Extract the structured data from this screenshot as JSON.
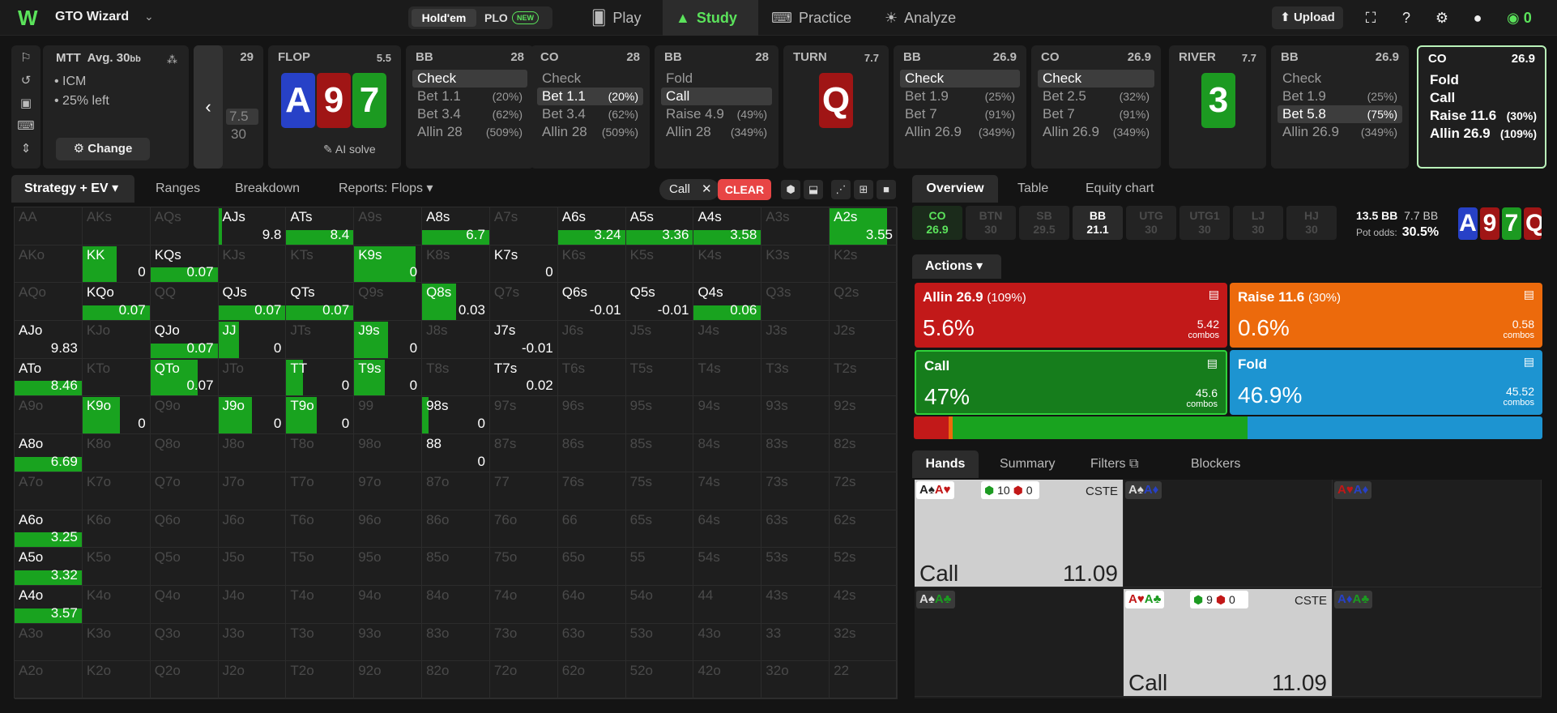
{
  "header": {
    "brand": "GTO Wizard",
    "game_a": "Hold'em",
    "game_b": "PLO",
    "game_new": "NEW",
    "nav": [
      "Play",
      "Study",
      "Practice",
      "Analyze"
    ],
    "upload": "Upload",
    "credits": "0"
  },
  "info": {
    "title": "MTT",
    "avg": "Avg. 30",
    "avg_unit": "bb",
    "line1": "ICM",
    "line2": "25% left",
    "change": "Change"
  },
  "preflop_stub": {
    "stack": "29",
    "a": "7.5",
    "b": "30"
  },
  "flop": {
    "label": "FLOP",
    "pot": "5.5",
    "cards": [
      "A",
      "9",
      "7"
    ],
    "ai": "AI solve"
  },
  "turn": {
    "label": "TURN",
    "pot": "7.7",
    "card": "Q"
  },
  "river": {
    "label": "RIVER",
    "pot": "7.7",
    "card": "3"
  },
  "columns": [
    {
      "pos": "BB",
      "stack": "28",
      "actions": [
        [
          "Check",
          ""
        ],
        [
          "Bet 1.1",
          "(20%)"
        ],
        [
          "Bet 3.4",
          "(62%)"
        ],
        [
          "Allin 28",
          "(509%)"
        ]
      ],
      "sel": 0
    },
    {
      "pos": "CO",
      "stack": "28",
      "actions": [
        [
          "Check",
          ""
        ],
        [
          "Bet 1.1",
          "(20%)"
        ],
        [
          "Bet 3.4",
          "(62%)"
        ],
        [
          "Allin 28",
          "(509%)"
        ]
      ],
      "sel": 1
    },
    {
      "pos": "BB",
      "stack": "28",
      "actions": [
        [
          "Fold",
          ""
        ],
        [
          "Call",
          ""
        ],
        [
          "Raise 4.9",
          "(49%)"
        ],
        [
          "Allin 28",
          "(349%)"
        ]
      ],
      "sel": 1
    },
    {
      "pos": "BB",
      "stack": "26.9",
      "actions": [
        [
          "Check",
          ""
        ],
        [
          "Bet 1.9",
          "(25%)"
        ],
        [
          "Bet 7",
          "(91%)"
        ],
        [
          "Allin 26.9",
          "(349%)"
        ]
      ],
      "sel": 0
    },
    {
      "pos": "CO",
      "stack": "26.9",
      "actions": [
        [
          "Check",
          ""
        ],
        [
          "Bet 2.5",
          "(32%)"
        ],
        [
          "Bet 7",
          "(91%)"
        ],
        [
          "Allin 26.9",
          "(349%)"
        ]
      ],
      "sel": 0
    },
    {
      "pos": "BB",
      "stack": "26.9",
      "actions": [
        [
          "Check",
          ""
        ],
        [
          "Bet 1.9",
          "(25%)"
        ],
        [
          "Bet 5.8",
          "(75%)"
        ],
        [
          "Allin 26.9",
          "(349%)"
        ]
      ],
      "sel": 2
    },
    {
      "pos": "CO",
      "stack": "26.9",
      "actions": [
        [
          "Fold",
          ""
        ],
        [
          "Call",
          ""
        ],
        [
          "Raise 11.6",
          "(30%)"
        ],
        [
          "Allin 26.9",
          "(109%)"
        ]
      ],
      "sel": -1
    }
  ],
  "ltabs": {
    "strategy": "Strategy + EV",
    "ranges": "Ranges",
    "breakdown": "Breakdown",
    "reports": "Reports: Flops",
    "chip": "Call",
    "clear": "CLEAR"
  },
  "matrix": {
    "cells": [
      [
        "AA",
        "",
        0
      ],
      [
        "AKs",
        "",
        0
      ],
      [
        "AQs",
        "",
        0
      ],
      [
        "AJs",
        "9.8",
        0.05
      ],
      [
        "ATs",
        "8.4",
        1
      ],
      [
        "A9s",
        "",
        0
      ],
      [
        "A8s",
        "6.7",
        1
      ],
      [
        "A7s",
        "",
        0
      ],
      [
        "A6s",
        "3.24",
        1
      ],
      [
        "A5s",
        "3.36",
        1
      ],
      [
        "A4s",
        "3.58",
        1
      ],
      [
        "A3s",
        "",
        0
      ],
      [
        "A2s",
        "3.55",
        0.85
      ],
      [
        "AKo",
        "",
        0
      ],
      [
        "KK",
        "0",
        0.5
      ],
      [
        "KQs",
        "0.07",
        1
      ],
      [
        "KJs",
        "",
        0
      ],
      [
        "KTs",
        "",
        0
      ],
      [
        "K9s",
        "0",
        0.9
      ],
      [
        "K8s",
        "",
        0
      ],
      [
        "K7s",
        "0",
        0
      ],
      [
        "K6s",
        "",
        0
      ],
      [
        "K5s",
        "",
        0
      ],
      [
        "K4s",
        "",
        0
      ],
      [
        "K3s",
        "",
        0
      ],
      [
        "K2s",
        "",
        0
      ],
      [
        "AQo",
        "",
        0
      ],
      [
        "KQo",
        "0.07",
        1
      ],
      [
        "QQ",
        "",
        0
      ],
      [
        "QJs",
        "0.07",
        1
      ],
      [
        "QTs",
        "0.07",
        1
      ],
      [
        "Q9s",
        "",
        0
      ],
      [
        "Q8s",
        "0.03",
        0.5
      ],
      [
        "Q7s",
        "",
        0
      ],
      [
        "Q6s",
        "-0.01",
        0
      ],
      [
        "Q5s",
        "-0.01",
        0
      ],
      [
        "Q4s",
        "0.06",
        1
      ],
      [
        "Q3s",
        "",
        0
      ],
      [
        "Q2s",
        "",
        0
      ],
      [
        "AJo",
        "9.83",
        0
      ],
      [
        "KJo",
        "",
        0
      ],
      [
        "QJo",
        "0.07",
        1
      ],
      [
        "JJ",
        "0",
        0.3
      ],
      [
        "JTs",
        "",
        0
      ],
      [
        "J9s",
        "0",
        0.5
      ],
      [
        "J8s",
        "",
        0
      ],
      [
        "J7s",
        "-0.01",
        0
      ],
      [
        "J6s",
        "",
        0
      ],
      [
        "J5s",
        "",
        0
      ],
      [
        "J4s",
        "",
        0
      ],
      [
        "J3s",
        "",
        0
      ],
      [
        "J2s",
        "",
        0
      ],
      [
        "ATo",
        "8.46",
        1
      ],
      [
        "KTo",
        "",
        0
      ],
      [
        "QTo",
        "0.07",
        0.7
      ],
      [
        "JTo",
        "",
        0
      ],
      [
        "TT",
        "0",
        0.25
      ],
      [
        "T9s",
        "0",
        0.45
      ],
      [
        "T8s",
        "",
        0
      ],
      [
        "T7s",
        "0.02",
        0
      ],
      [
        "T6s",
        "",
        0
      ],
      [
        "T5s",
        "",
        0
      ],
      [
        "T4s",
        "",
        0
      ],
      [
        "T3s",
        "",
        0
      ],
      [
        "T2s",
        "",
        0
      ],
      [
        "A9o",
        "",
        0
      ],
      [
        "K9o",
        "0",
        0.55
      ],
      [
        "Q9o",
        "",
        0
      ],
      [
        "J9o",
        "0",
        0.5
      ],
      [
        "T9o",
        "0",
        0.45
      ],
      [
        "99",
        "",
        0
      ],
      [
        "98s",
        "0",
        0.1
      ],
      [
        "97s",
        "",
        0
      ],
      [
        "96s",
        "",
        0
      ],
      [
        "95s",
        "",
        0
      ],
      [
        "94s",
        "",
        0
      ],
      [
        "93s",
        "",
        0
      ],
      [
        "92s",
        "",
        0
      ],
      [
        "A8o",
        "6.69",
        1
      ],
      [
        "K8o",
        "",
        0
      ],
      [
        "Q8o",
        "",
        0
      ],
      [
        "J8o",
        "",
        0
      ],
      [
        "T8o",
        "",
        0
      ],
      [
        "98o",
        "",
        0
      ],
      [
        "88",
        "0",
        0
      ],
      [
        "87s",
        "",
        0
      ],
      [
        "86s",
        "",
        0
      ],
      [
        "85s",
        "",
        0
      ],
      [
        "84s",
        "",
        0
      ],
      [
        "83s",
        "",
        0
      ],
      [
        "82s",
        "",
        0
      ],
      [
        "A7o",
        "",
        0
      ],
      [
        "K7o",
        "",
        0
      ],
      [
        "Q7o",
        "",
        0
      ],
      [
        "J7o",
        "",
        0
      ],
      [
        "T7o",
        "",
        0
      ],
      [
        "97o",
        "",
        0
      ],
      [
        "87o",
        "",
        0
      ],
      [
        "77",
        "",
        0
      ],
      [
        "76s",
        "",
        0
      ],
      [
        "75s",
        "",
        0
      ],
      [
        "74s",
        "",
        0
      ],
      [
        "73s",
        "",
        0
      ],
      [
        "72s",
        "",
        0
      ],
      [
        "A6o",
        "3.25",
        1
      ],
      [
        "K6o",
        "",
        0
      ],
      [
        "Q6o",
        "",
        0
      ],
      [
        "J6o",
        "",
        0
      ],
      [
        "T6o",
        "",
        0
      ],
      [
        "96o",
        "",
        0
      ],
      [
        "86o",
        "",
        0
      ],
      [
        "76o",
        "",
        0
      ],
      [
        "66",
        "",
        0
      ],
      [
        "65s",
        "",
        0
      ],
      [
        "64s",
        "",
        0
      ],
      [
        "63s",
        "",
        0
      ],
      [
        "62s",
        "",
        0
      ],
      [
        "A5o",
        "3.32",
        1
      ],
      [
        "K5o",
        "",
        0
      ],
      [
        "Q5o",
        "",
        0
      ],
      [
        "J5o",
        "",
        0
      ],
      [
        "T5o",
        "",
        0
      ],
      [
        "95o",
        "",
        0
      ],
      [
        "85o",
        "",
        0
      ],
      [
        "75o",
        "",
        0
      ],
      [
        "65o",
        "",
        0
      ],
      [
        "55",
        "",
        0
      ],
      [
        "54s",
        "",
        0
      ],
      [
        "53s",
        "",
        0
      ],
      [
        "52s",
        "",
        0
      ],
      [
        "A4o",
        "3.57",
        1
      ],
      [
        "K4o",
        "",
        0
      ],
      [
        "Q4o",
        "",
        0
      ],
      [
        "J4o",
        "",
        0
      ],
      [
        "T4o",
        "",
        0
      ],
      [
        "94o",
        "",
        0
      ],
      [
        "84o",
        "",
        0
      ],
      [
        "74o",
        "",
        0
      ],
      [
        "64o",
        "",
        0
      ],
      [
        "54o",
        "",
        0
      ],
      [
        "44",
        "",
        0
      ],
      [
        "43s",
        "",
        0
      ],
      [
        "42s",
        "",
        0
      ],
      [
        "A3o",
        "",
        0
      ],
      [
        "K3o",
        "",
        0
      ],
      [
        "Q3o",
        "",
        0
      ],
      [
        "J3o",
        "",
        0
      ],
      [
        "T3o",
        "",
        0
      ],
      [
        "93o",
        "",
        0
      ],
      [
        "83o",
        "",
        0
      ],
      [
        "73o",
        "",
        0
      ],
      [
        "63o",
        "",
        0
      ],
      [
        "53o",
        "",
        0
      ],
      [
        "43o",
        "",
        0
      ],
      [
        "33",
        "",
        0
      ],
      [
        "32s",
        "",
        0
      ],
      [
        "A2o",
        "",
        0
      ],
      [
        "K2o",
        "",
        0
      ],
      [
        "Q2o",
        "",
        0
      ],
      [
        "J2o",
        "",
        0
      ],
      [
        "T2o",
        "",
        0
      ],
      [
        "92o",
        "",
        0
      ],
      [
        "82o",
        "",
        0
      ],
      [
        "72o",
        "",
        0
      ],
      [
        "62o",
        "",
        0
      ],
      [
        "52o",
        "",
        0
      ],
      [
        "42o",
        "",
        0
      ],
      [
        "32o",
        "",
        0
      ],
      [
        "22",
        "",
        0
      ]
    ]
  },
  "rtabs": {
    "overview": "Overview",
    "table": "Table",
    "equity": "Equity chart"
  },
  "positions": [
    [
      "CO",
      "26.9"
    ],
    [
      "BTN",
      "30"
    ],
    [
      "SB",
      "29.5"
    ],
    [
      "BB",
      "21.1"
    ],
    [
      "UTG",
      "30"
    ],
    [
      "UTG1",
      "30"
    ],
    [
      "LJ",
      "30"
    ],
    [
      "HJ",
      "30"
    ]
  ],
  "pot": {
    "pot": "13.5 BB",
    "bet": "7.7 BB",
    "odds_label": "Pot odds:",
    "odds": "30.5%"
  },
  "actions": {
    "title": "Actions",
    "items": [
      {
        "name": "Allin 26.9",
        "pct": "(109%)",
        "freq": "5.6%",
        "combos": "5.42",
        "unit": "combos",
        "color": "#c21919"
      },
      {
        "name": "Raise 11.6",
        "pct": "(30%)",
        "freq": "0.6%",
        "combos": "0.58",
        "unit": "combos",
        "color": "#ec6a0c"
      },
      {
        "name": "Call",
        "pct": "",
        "freq": "47%",
        "combos": "45.6",
        "unit": "combos",
        "color": "#167d1c"
      },
      {
        "name": "Fold",
        "pct": "",
        "freq": "46.9%",
        "combos": "45.52",
        "unit": "combos",
        "color": "#1d94d1"
      }
    ],
    "freqbar": [
      0.056,
      0.006,
      0.47,
      0.469
    ]
  },
  "htabs": {
    "hands": "Hands",
    "summary": "Summary",
    "filters": "Filters",
    "blockers": "Blockers"
  },
  "hands": [
    {
      "c1": "A",
      "s1": "♠",
      "col1": "blk",
      "c2": "A",
      "s2": "♥",
      "col2": "red",
      "big": true,
      "b1": "10",
      "b2": "0",
      "tag": "CSTE",
      "act": "Call",
      "val": "11.09"
    },
    {
      "c1": "A",
      "s1": "♠",
      "col1": "blk",
      "c2": "A",
      "s2": "♦",
      "col2": "blu",
      "big": false
    },
    {
      "c1": "A",
      "s1": "♥",
      "col1": "red",
      "c2": "A",
      "s2": "♦",
      "col2": "blu",
      "big": false
    },
    {
      "c1": "A",
      "s1": "♠",
      "col1": "blk",
      "c2": "A",
      "s2": "♣",
      "col2": "grn",
      "big": false
    },
    {
      "c1": "A",
      "s1": "♥",
      "col1": "red",
      "c2": "A",
      "s2": "♣",
      "col2": "grn",
      "big": true,
      "b1": "9",
      "b2": "0",
      "tag": "CSTE",
      "act": "Call",
      "val": "11.09"
    },
    {
      "c1": "A",
      "s1": "♦",
      "col1": "blu",
      "c2": "A",
      "s2": "♣",
      "col2": "grn",
      "big": false
    }
  ]
}
